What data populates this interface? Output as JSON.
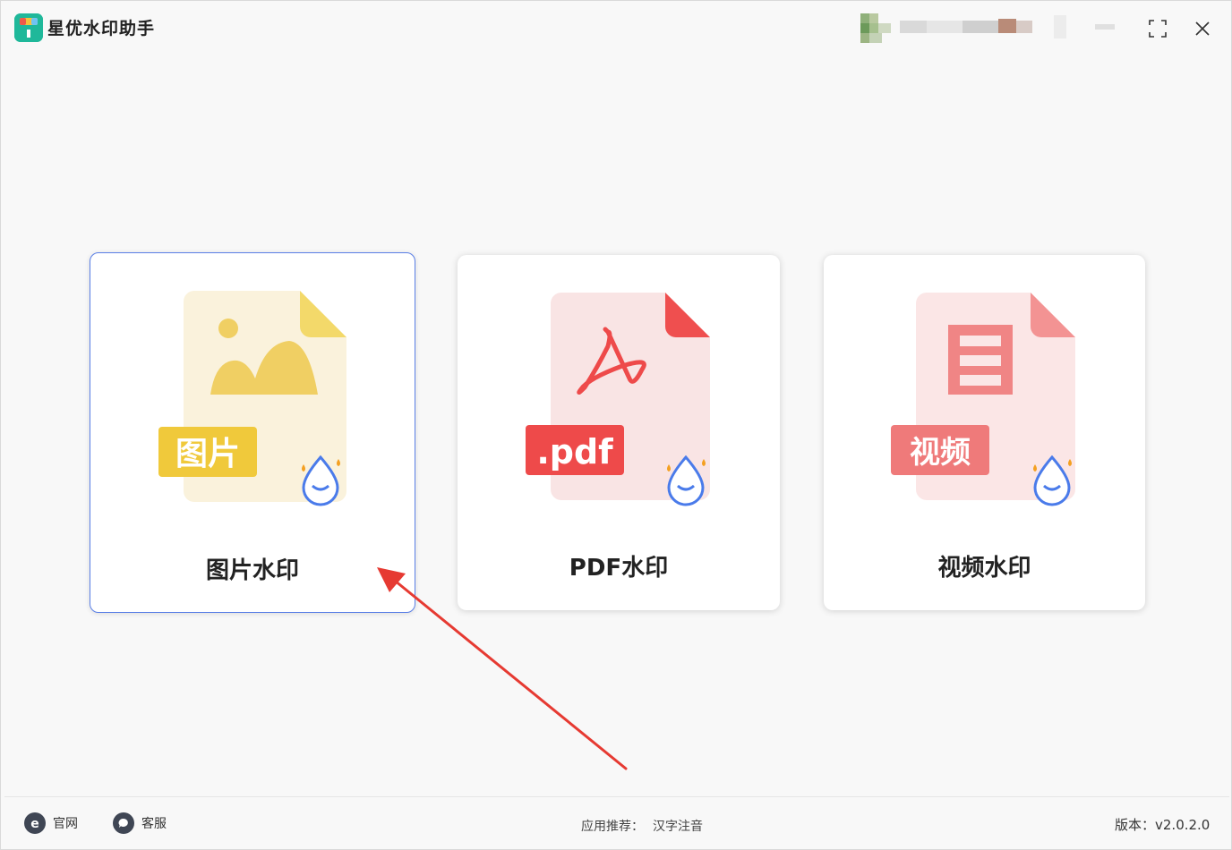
{
  "app": {
    "title": "星优水印助手",
    "icon": "paint-roller-icon"
  },
  "header": {
    "user_info": "blurred-user-info",
    "maximize_icon": "maximize-icon",
    "close_icon": "close-icon"
  },
  "cards": [
    {
      "label": "图片水印",
      "badge": "图片",
      "icon": "image-file-icon",
      "accent": "#f0c93b",
      "bg": "#faf2dc"
    },
    {
      "label": "PDF水印",
      "badge": ".pdf",
      "icon": "pdf-file-icon",
      "accent": "#ee4a4a",
      "bg": "#f9e4e4"
    },
    {
      "label": "视频水印",
      "badge": "视频",
      "icon": "video-file-icon",
      "accent": "#ef7a7a",
      "bg": "#fbe6e6"
    }
  ],
  "footer": {
    "site_label": "官网",
    "service_label": "客服",
    "recommend_prefix": "应用推荐：",
    "recommend_link": "汉字注音",
    "version": "版本：v2.0.2.0"
  },
  "colors": {
    "active_border": "#5a7fe6",
    "arrow": "#e63a32",
    "drop": "#4a7bea",
    "drop_accent": "#f4a021"
  }
}
